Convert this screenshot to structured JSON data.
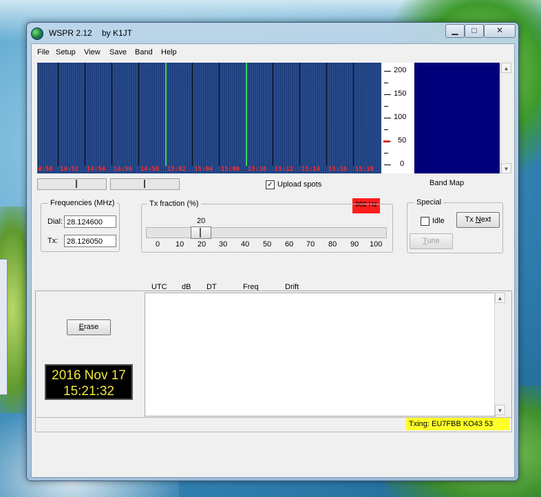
{
  "window": {
    "title": "WSPR 2.12",
    "subtitle": "by K1JT",
    "controls": {
      "minimize": "▁",
      "maximize": "□",
      "close": "✕"
    }
  },
  "menu": [
    "File",
    "Setup",
    "View",
    "Save",
    "Band",
    "Help"
  ],
  "waterfall": {
    "time_labels": [
      "4:50",
      "14:52",
      "14:54",
      "14:56",
      "14:58",
      "15:02",
      "15:04",
      "15:06",
      "15:10",
      "15:12",
      "15:14",
      "15:16",
      "15:18"
    ]
  },
  "scale": {
    "labels": [
      "200",
      "150",
      "100",
      "50",
      "0"
    ],
    "marker_value": 50
  },
  "upload_spots": {
    "label": "Upload spots",
    "checked": true,
    "check_glyph": "✓"
  },
  "freq_offset": "982 Hz",
  "band_map_label": "Band Map",
  "frequencies": {
    "title": "Frequencies (MHz)",
    "dial_label": "Dial:",
    "dial_value": "28.124600",
    "tx_label": "Tx:",
    "tx_value": "28.126050"
  },
  "tx_fraction": {
    "title": "Tx fraction (%)",
    "value": "20",
    "ticks": [
      "0",
      "10",
      "20",
      "30",
      "40",
      "50",
      "60",
      "70",
      "80",
      "90",
      "100"
    ]
  },
  "special": {
    "title": "Special",
    "idle_label": "Idle",
    "idle_checked": false,
    "tx_next_prefix": "Tx ",
    "tx_next_ul": "N",
    "tx_next_suffix": "ext",
    "tune_ul": "T",
    "tune_rest": "une"
  },
  "columns": [
    "UTC",
    "dB",
    "DT",
    "Freq",
    "Drift"
  ],
  "erase": {
    "ul": "E",
    "rest": "rase"
  },
  "clock": {
    "date": "2016 Nov 17",
    "time": "15:21:32"
  },
  "status": {
    "txing": "Txing: EU7FBB KO43 53"
  },
  "colors": {
    "waterfall_bg": "#1b3a78",
    "band_map": "#00007a",
    "freq_box": "#ff1c1c",
    "txing_bg": "#ffff2a",
    "clock_text": "#f3e93a"
  }
}
